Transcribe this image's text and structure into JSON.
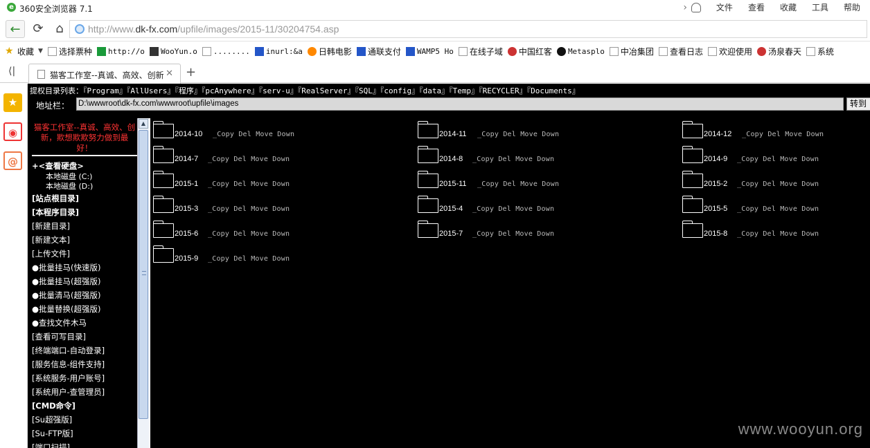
{
  "window": {
    "title": "360安全浏览器 7.1",
    "menus": [
      "文件",
      "查看",
      "收藏",
      "工具",
      "帮助"
    ]
  },
  "address": {
    "url_prefix": "http://www.",
    "url_host": "dk-fx.com",
    "url_path": "/upfile/images/2015-11/30204754.asp"
  },
  "bookmarks": [
    {
      "label": "收藏",
      "icon": "star-icon"
    },
    {
      "label": "选择票种",
      "icon": "page-icon"
    },
    {
      "label": "http://o",
      "icon": "gear-icon"
    },
    {
      "label": "WooYun.o",
      "icon": "wooyun-icon"
    },
    {
      "label": "........",
      "icon": "page-icon"
    },
    {
      "label": "inurl:&a",
      "icon": "paw-icon"
    },
    {
      "label": "日韩电影",
      "icon": "play-icon"
    },
    {
      "label": "通联支付",
      "icon": "plane-icon"
    },
    {
      "label": "WAMP5 Ho",
      "icon": "plane-icon"
    },
    {
      "label": "在线子域",
      "icon": "cat-icon"
    },
    {
      "label": "中国红客",
      "icon": "badge-icon"
    },
    {
      "label": "Metasplo",
      "icon": "metasploit-icon"
    },
    {
      "label": "中冶集团",
      "icon": "page-icon"
    },
    {
      "label": "查看日志",
      "icon": "page-icon"
    },
    {
      "label": "欢迎使用",
      "icon": "page-icon"
    },
    {
      "label": "汤泉春天",
      "icon": "shield-icon"
    },
    {
      "label": "系统",
      "icon": "page-icon"
    }
  ],
  "tab": {
    "title": "猫客工作室--真诚、高效、创新"
  },
  "content": {
    "dir_list_lead": "提权目录列表：",
    "dir_list": "『Program』『AllUsers』『程序』『pcAnywhere』『serv-u』『RealServer』『SQL』『config』『data』『Temp』『RECYCLER』『Documents』",
    "path_label": "地址栏：",
    "path_value": "D:\\wwwroot\\dk-fx.com\\wwwroot\\upfile\\images",
    "go_label": "转到",
    "slogan": "猫客工作室--真诚、高效、创新，欺想欺欺努力做到最好！",
    "menu": [
      {
        "label": "+<查看硬盘>",
        "style": "hdr bold"
      },
      {
        "label": "本地磁盘 (C:)",
        "style": "ind"
      },
      {
        "label": "本地磁盘 (D:)",
        "style": "ind"
      },
      {
        "label": "[站点根目录]",
        "style": "bold"
      },
      {
        "label": "[本程序目录]",
        "style": "bold"
      },
      {
        "label": "[新建目录]",
        "style": ""
      },
      {
        "label": "[新建文本]",
        "style": ""
      },
      {
        "label": "[上传文件]",
        "style": ""
      },
      {
        "label": "●批量挂马(快速版)",
        "style": ""
      },
      {
        "label": "●批量挂马(超强版)",
        "style": ""
      },
      {
        "label": "●批量清马(超强版)",
        "style": ""
      },
      {
        "label": "●批量替换(超强版)",
        "style": ""
      },
      {
        "label": "●查找文件木马",
        "style": ""
      },
      {
        "label": "[查看可写目录]",
        "style": ""
      },
      {
        "label": "[终端端口-自动登录]",
        "style": ""
      },
      {
        "label": "[服务信息-组件支持]",
        "style": ""
      },
      {
        "label": "[系统服务-用户账号]",
        "style": ""
      },
      {
        "label": "[系统用户-查管理员]",
        "style": ""
      },
      {
        "label": "[CMD命令]",
        "style": "bold"
      },
      {
        "label": "[Su超强版]",
        "style": ""
      },
      {
        "label": "[Su-FTP版]",
        "style": ""
      },
      {
        "label": "[端口扫描]",
        "style": ""
      }
    ],
    "folder_actions": "_Copy Del Move Down",
    "folders": [
      "2014-10",
      "2014-11",
      "2014-12",
      "2014-7",
      "2014-8",
      "2014-9",
      "2015-1",
      "2015-11",
      "2015-2",
      "2015-3",
      "2015-4",
      "2015-5",
      "2015-6",
      "2015-7",
      "2015-8",
      "2015-9"
    ]
  },
  "watermark": "www.wooyun.org"
}
